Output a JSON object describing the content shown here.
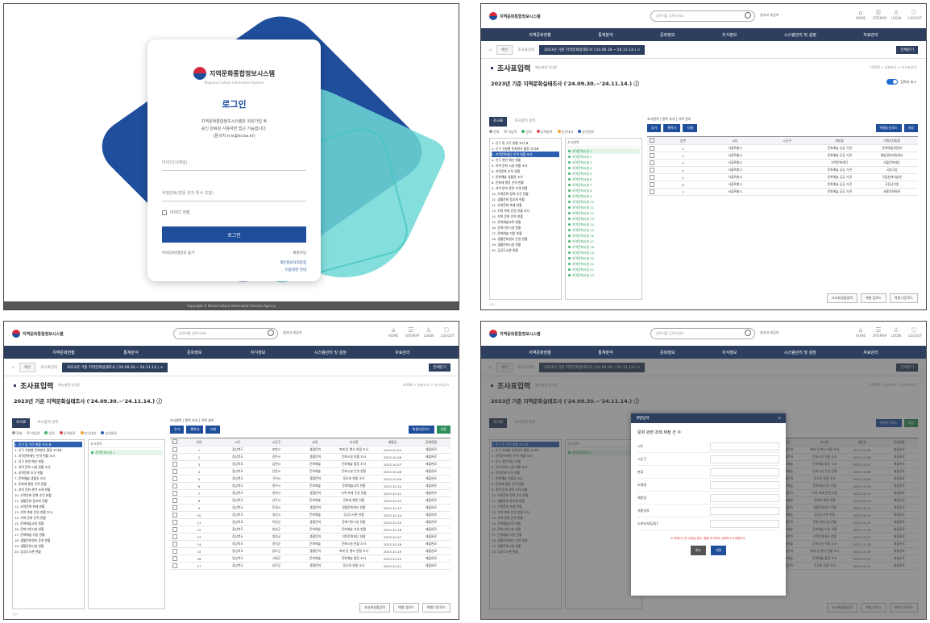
{
  "login": {
    "org_name": "지역문화통합정보시스템",
    "org_sub": "Regional Culture Information System",
    "title": "로그인",
    "desc_line1": "지역문화통합정보시스템은 회원가입 후",
    "desc_line2": "승인 완료된 사용자만 접근 가능합니다.",
    "desc_line3": "(문의처:rcis@kcisa.kr)",
    "id_placeholder": "아이디(이메일)",
    "pw_placeholder": "비밀번호(영문 숫자 특수 조합)",
    "remember_label": "아이디 저장",
    "button": "로그인",
    "find_link": "아이디/비밀번호 찾기",
    "signup_link": "회원가입",
    "privacy_link": "개인정보처리방침",
    "terms_link": "이용약관 안내",
    "footer": "Copyright © Korea Culture Information Service Agency"
  },
  "app": {
    "brand": "지역문화통합정보시스템",
    "search_placeholder": "검색어를 입력하세요",
    "search_check": "결과내 재검색",
    "top_icons": [
      {
        "glyph": "⌂",
        "label": "HOME"
      },
      {
        "glyph": "☰",
        "label": "SITEMAP"
      },
      {
        "glyph": "♙",
        "label": "LOGIN"
      },
      {
        "glyph": "⎋",
        "label": "LOGOUT"
      }
    ],
    "nav": [
      "지역문화현황",
      "통계분석",
      "문화정보",
      "지식정보",
      "시스템관리 및 설정",
      "자료관리"
    ],
    "tabs": {
      "home": "⌂",
      "pill": "메인",
      "link": "조사표입력",
      "active": "2023년 기준 지역문화실태조사 ('24.09.30.~'24.11.14.) ×",
      "close_all": "전체닫기"
    },
    "page_title": "조사표입력",
    "page_sub": "메뉴설명 안내문",
    "crumbs": "HOME > 실태조사 > 조사표입력",
    "survey_title": "2023년 기준 지역문화실태조사 ('24.09.30.~'24.11.14.) ⓘ",
    "toggle_label": "입력자 표시",
    "left_tab_on": "조사표",
    "left_tab_off": "조사항목 관리",
    "legend": [
      "전체",
      "미입력",
      "입력",
      "입력완료",
      "승인대기",
      "승인완료"
    ],
    "tree": [
      "1. 인구 및 가구 현황 조사 표",
      "2. 인구 유형별 문화향유 활동 조사표",
      "3. 지역문화재단 인력 현황 조사",
      "4. 인구 관련 예산 현황",
      "5. 지역 문화 시설 현황 조사",
      "6. 지역문화 조직 현황",
      "7. 문화예술 생활권 조사",
      "8. 문화재 행정 인력 현황",
      "9. 지역 문화 관련 조례 현황",
      "10. 지역문화 정책 추진 현황",
      "11. 생활문화 동호회 현황",
      "12. 지역문화 축제 현황",
      "13. 지역 축제 운영 현황 조사",
      "14. 지역 문화 인력 현황",
      "15. 문화예술교육 현황",
      "16. 문화기반시설 현황",
      "17. 문화예술 지원 현황",
      "18. 생활문화센터 운영 현황",
      "19. 생활문화시설 현황",
      "20. 공공도서관 현황"
    ],
    "list_head": "조사항목",
    "list_items": [
      "지역문화시설 1",
      "지역문화시설 2",
      "지역문화시설 3",
      "지역문화시설 4",
      "지역문화시설 5",
      "지역문화시설 6",
      "지역문화시설 7",
      "지역문화시설 8",
      "지역문화시설 9",
      "지역문화시설 10",
      "지역문화시설 11",
      "지역문화시설 12",
      "지역문화시설 13",
      "지역문화시설 14",
      "지역문화시설 15",
      "지역문화시설 16",
      "지역문화시설 17",
      "지역문화시설 18",
      "지역문화시설 19",
      "지역문화시설 20",
      "지역문화시설 21",
      "지역문화시설 22",
      "지역문화시설 23"
    ],
    "grid_links": "조사항목 | 항목 추가 | 이력 관리",
    "buttons": [
      "추가",
      "행복사",
      "삭제"
    ],
    "green_buttons": [
      "엑셀다운로드",
      "저장"
    ],
    "columns2": [
      "순번",
      "시도",
      "시군구",
      "대분류",
      "기관(단체)명"
    ],
    "rows2": [
      [
        "1",
        "서울특별시",
        "",
        "문화예술 공공 기관",
        "문화예술위원회"
      ],
      [
        "2",
        "서울특별시",
        "",
        "문화예술 공공 기관",
        "예술경영지원센터"
      ],
      [
        "3",
        "서울특별시",
        "",
        "지역문화재단",
        "서울문화재단"
      ],
      [
        "4",
        "서울특별시",
        "",
        "문화예술 공공 기관",
        "국립극장"
      ],
      [
        "5",
        "서울특별시",
        "",
        "문화예술 공공 기관",
        "국립현대미술관"
      ],
      [
        "6",
        "서울특별시",
        "",
        "문화예술 공공 기관",
        "국립국악원"
      ],
      [
        "7",
        "서울특별시",
        "",
        "문화예술 공공 기관",
        "세종문화회관"
      ]
    ],
    "columns3": [
      "순번",
      "시도",
      "시군구",
      "분류",
      "조사명",
      "제출일",
      "진행현황"
    ],
    "rows3": [
      [
        "1",
        "경상북도",
        "포항시",
        "생활문화",
        "축제 및 행사 현황 조사",
        "2023-10-05",
        "제출완료"
      ],
      [
        "2",
        "경상북도",
        "경주시",
        "생활문화",
        "문화시설 현황 조사",
        "2023-10-06",
        "제출완료"
      ],
      [
        "3",
        "경상북도",
        "김천시",
        "문화예술",
        "문화예술 활동 조사",
        "2023-10-07",
        "제출완료"
      ],
      [
        "4",
        "경상북도",
        "안동시",
        "문화예술",
        "문화시설 운영 현황",
        "2023-10-08",
        "제출완료"
      ],
      [
        "5",
        "경상북도",
        "구미시",
        "생활문화",
        "동호회 현황 조사",
        "2023-10-09",
        "제출완료"
      ],
      [
        "6",
        "경상북도",
        "영주시",
        "문화예술",
        "문화예술교육 현황",
        "2023-10-10",
        "제출완료"
      ],
      [
        "7",
        "경상북도",
        "영천시",
        "생활문화",
        "지역 축제 운영 현황",
        "2023-10-11",
        "제출완료"
      ],
      [
        "8",
        "경상북도",
        "상주시",
        "문화예술",
        "문화재 행정 현황",
        "2023-10-12",
        "제출완료"
      ],
      [
        "9",
        "경상북도",
        "문경시",
        "생활문화",
        "생활문화센터 현황",
        "2023-10-13",
        "제출완료"
      ],
      [
        "10",
        "경상북도",
        "경산시",
        "문화예술",
        "공공도서관 현황",
        "2023-10-14",
        "제출완료"
      ],
      [
        "11",
        "경상북도",
        "의성군",
        "생활문화",
        "문화기반시설 현황",
        "2023-10-15",
        "제출완료"
      ],
      [
        "12",
        "경상북도",
        "청송군",
        "문화예술",
        "문화예술 지원 현황",
        "2023-10-16",
        "제출완료"
      ],
      [
        "13",
        "경상북도",
        "영양군",
        "생활문화",
        "지역문화재단 현황",
        "2023-10-17",
        "제출완료"
      ],
      [
        "14",
        "경상북도",
        "영덕군",
        "문화예술",
        "문화시설 현황 조사",
        "2023-10-18",
        "제출완료"
      ],
      [
        "15",
        "경상북도",
        "청도군",
        "생활문화",
        "축제 및 행사 현황 조사",
        "2023-10-19",
        "제출완료"
      ],
      [
        "16",
        "경상북도",
        "고령군",
        "문화예술",
        "문화예술 활동 조사",
        "2023-10-20",
        "제출완료"
      ],
      [
        "17",
        "경상북도",
        "성주군",
        "생활문화",
        "동호회 현황 조사",
        "2023-10-21",
        "제출완료"
      ]
    ],
    "bottom_btns": [
      "조사표일괄입력",
      "엑셀 업로드",
      "엑셀 다운로드"
    ],
    "pager": "◁ ▷"
  },
  "modal": {
    "header": "개별입력",
    "close": "×",
    "question": "문화 관련 조례 제정 건 수",
    "fields": [
      "시도",
      "시군구",
      "분류",
      "조례명",
      "제정일",
      "개정일자",
      "소관부서(담당)"
    ],
    "note": "※ 조례가 2건 이상일 경우, 행을 추가하여 입력하시기 바랍니다.",
    "cancel": "취소",
    "save": "저장"
  },
  "colors": {
    "navy": "#1f4e9c",
    "nav_dark": "#2d3e5e",
    "teal": "#6fd8d6",
    "green": "#2f8f5a"
  }
}
